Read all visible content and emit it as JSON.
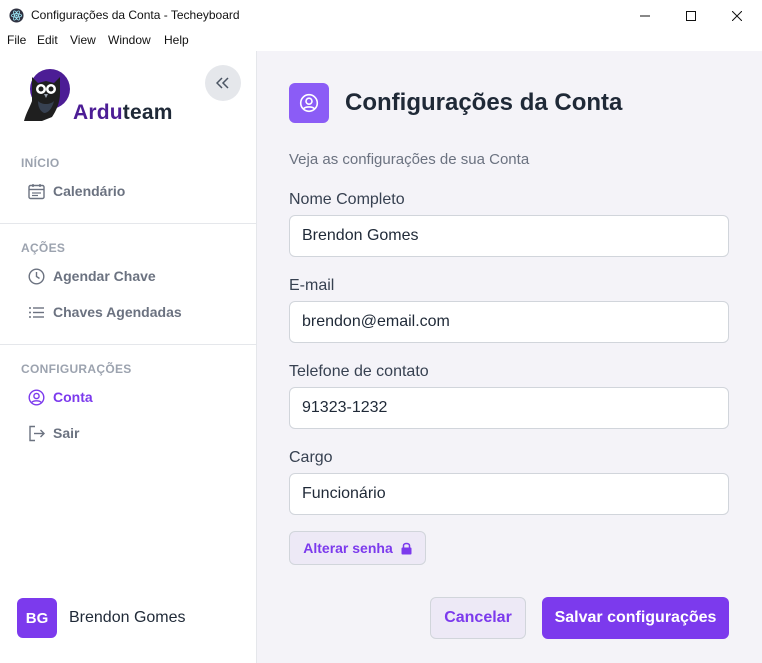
{
  "window": {
    "title": "Configurações da Conta - Techeyboard",
    "controls": [
      "minimize",
      "maximize",
      "close"
    ]
  },
  "menu": [
    "File",
    "Edit",
    "View",
    "Window",
    "Help"
  ],
  "sidebar": {
    "brand_part1": "Ardu",
    "brand_part2": "team",
    "sections": [
      {
        "label": "INÍCIO",
        "items": [
          {
            "label": "Calendário",
            "icon": "calendar-icon"
          }
        ]
      },
      {
        "label": "AÇÕES",
        "items": [
          {
            "label": "Agendar Chave",
            "icon": "clock-icon"
          },
          {
            "label": "Chaves Agendadas",
            "icon": "list-icon"
          }
        ]
      },
      {
        "label": "CONFIGURAÇÕES",
        "items": [
          {
            "label": "Conta",
            "icon": "user-circle-icon",
            "active": true
          },
          {
            "label": "Sair",
            "icon": "logout-icon"
          }
        ]
      }
    ],
    "user": {
      "initials": "BG",
      "name": "Brendon Gomes"
    }
  },
  "main": {
    "title": "Configurações da Conta",
    "subtitle": "Veja as configurações de sua Conta",
    "fields": [
      {
        "label": "Nome Completo",
        "value": "Brendon Gomes"
      },
      {
        "label": "E-mail",
        "value": "brendon@email.com"
      },
      {
        "label": "Telefone de contato",
        "value": "91323-1232"
      },
      {
        "label": "Cargo",
        "value": "Funcionário"
      }
    ],
    "change_password_label": "Alterar senha",
    "cancel_label": "Cancelar",
    "save_label": "Salvar configurações"
  },
  "colors": {
    "accent": "#7c3aed",
    "accent_light": "#8b5cf6",
    "brand_dark": "#4c1d95",
    "main_bg": "#f4f3f8"
  }
}
